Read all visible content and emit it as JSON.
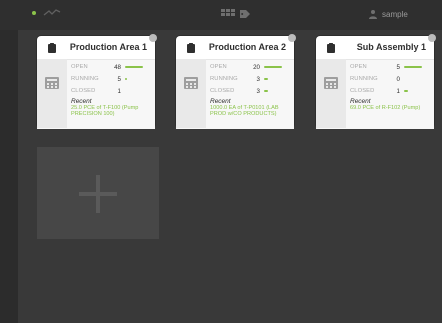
{
  "topbar": {
    "user_label": "sample"
  },
  "icons": {
    "status_dot": "status-dot-icon",
    "logo": "product-logo-icon",
    "grid": "grid-icon",
    "tag": "tag-icon",
    "user": "user-icon",
    "bag": "clipboard-icon",
    "calculator": "calculator-icon",
    "plus": "plus-icon"
  },
  "colors": {
    "accent": "#8bc34a",
    "background": "#393939",
    "topbar": "#2f2f2f"
  },
  "cards": [
    {
      "title": "Production Area 1",
      "stats": [
        {
          "label": "OPEN",
          "value": "48",
          "fraction": 0.65
        },
        {
          "label": "RUNNING",
          "value": "5",
          "fraction": 0.07
        },
        {
          "label": "CLOSED",
          "value": "1",
          "fraction": 0.0
        }
      ],
      "recent_label": "Recent",
      "recent_text": "25.0 PCE of T-F100 (Pump PRECISION 100)"
    },
    {
      "title": "Production Area 2",
      "stats": [
        {
          "label": "OPEN",
          "value": "20",
          "fraction": 0.65
        },
        {
          "label": "RUNNING",
          "value": "3",
          "fraction": 0.14
        },
        {
          "label": "CLOSED",
          "value": "3",
          "fraction": 0.14
        }
      ],
      "recent_label": "Recent",
      "recent_text": "1000.0 EA of T-P0101 (LAB PROD w/CO PRODUCTS)"
    },
    {
      "title": "Sub Assembly 1",
      "stats": [
        {
          "label": "OPEN",
          "value": "5",
          "fraction": 0.65
        },
        {
          "label": "RUNNING",
          "value": "0",
          "fraction": 0.0
        },
        {
          "label": "CLOSED",
          "value": "1",
          "fraction": 0.14
        }
      ],
      "recent_label": "Recent",
      "recent_text": "69.0 PCE of R-F102 (Pump)"
    }
  ]
}
